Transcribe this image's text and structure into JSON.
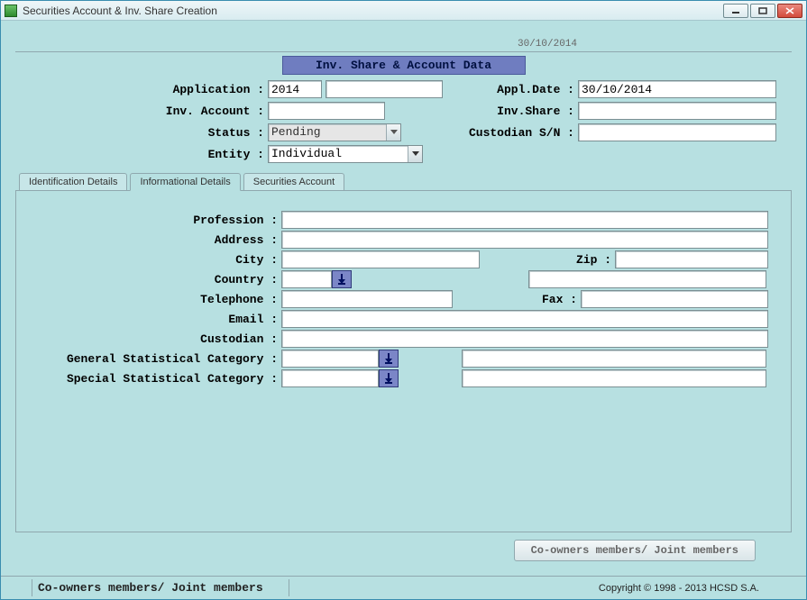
{
  "window": {
    "title": "Securities Account & Inv. Share Creation"
  },
  "header": {
    "date_top": "30/10/2014",
    "section_title": "Inv. Share & Account Data"
  },
  "top_form": {
    "application_label": "Application :",
    "application_value": "2014",
    "application_value2": "",
    "appl_date_label": "Appl.Date :",
    "appl_date_value": "30/10/2014",
    "inv_account_label": "Inv. Account :",
    "inv_account_value": "",
    "inv_share_label": "Inv.Share :",
    "inv_share_value": "",
    "status_label": "Status :",
    "status_value": "Pending",
    "custodian_sn_label": "Custodian S/N :",
    "custodian_sn_value": "",
    "entity_label": "Entity :",
    "entity_value": "Individual"
  },
  "tabs": {
    "identification": "Identification Details",
    "informational": "Informational Details",
    "securities": "Securities Account"
  },
  "info_tab": {
    "profession_label": "Profession :",
    "profession_value": "",
    "address_label": "Address :",
    "address_value": "",
    "city_label": "City :",
    "city_value": "",
    "zip_label": "Zip :",
    "zip_value": "",
    "country_label": "Country :",
    "country_code": "",
    "country_name": "",
    "telephone_label": "Telephone :",
    "telephone_value": "",
    "fax_label": "Fax :",
    "fax_value": "",
    "email_label": "Email :",
    "email_value": "",
    "custodian_label": "Custodian :",
    "custodian_value": "",
    "gen_stat_label": "General Statistical Category :",
    "gen_stat_code": "",
    "gen_stat_name": "",
    "spec_stat_label": "Special Statistical Category :",
    "spec_stat_code": "",
    "spec_stat_name": ""
  },
  "buttons": {
    "coowners": "Co-owners members/ Joint members"
  },
  "statusbar": {
    "left": "Co-owners members/ Joint members",
    "copyright": "Copyright © 1998 - 2013 HCSD S.A."
  }
}
